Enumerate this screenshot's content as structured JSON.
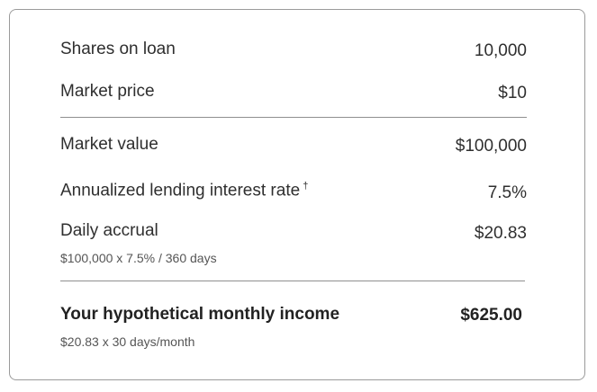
{
  "rows": [
    {
      "label": "Shares on loan",
      "value": "10,000"
    },
    {
      "label": "Market price",
      "value": "$10"
    },
    {
      "label": "Market value",
      "value": "$100,000"
    },
    {
      "label": "Annualized lending interest rate",
      "footnote_mark": "†",
      "value": "7.5%"
    },
    {
      "label": "Daily accrual",
      "value": "$20.83",
      "formula": "$100,000 x 7.5% / 360 days"
    }
  ],
  "total": {
    "label": "Your hypothetical monthly income",
    "value": "$625.00",
    "formula": "$20.83 x 30 days/month"
  }
}
